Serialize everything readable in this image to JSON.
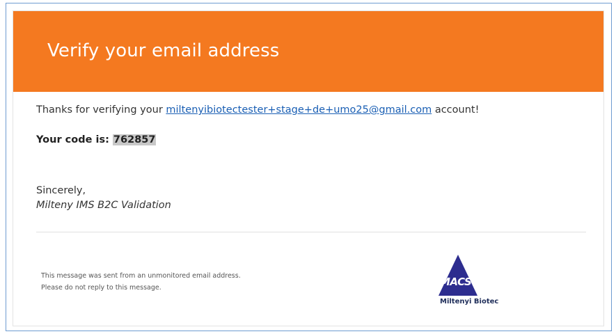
{
  "email": {
    "header_title": "Verify your email address",
    "thanks_prefix": "Thanks for verifying your ",
    "email_address": "miltenyibiotectester+stage+de+umo25@gmail.com",
    "thanks_suffix": " account!",
    "code_label": "Your code is: ",
    "code_value": "762857",
    "closing": "Sincerely,",
    "signature": "Milteny IMS B2C Validation",
    "footer_line1": "This message was sent from an unmonitored email address.",
    "footer_line2": "Please do not reply to this message.",
    "logo_mark": "MACS",
    "logo_company": "Miltenyi Biotec"
  },
  "colors": {
    "header_background": "#f47920",
    "link": "#1a5fb4",
    "logo_triangle": "#2d2d8f"
  }
}
